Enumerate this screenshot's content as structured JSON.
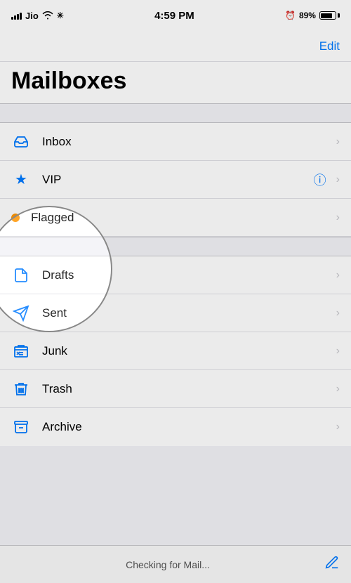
{
  "statusBar": {
    "carrier": "Jio",
    "time": "4:59 PM",
    "battery": "89%",
    "alarmIcon": "⏰"
  },
  "navBar": {
    "editLabel": "Edit"
  },
  "page": {
    "title": "Mailboxes"
  },
  "topSection": {
    "items": [
      {
        "id": "inbox",
        "label": "Inbox",
        "icon": "inbox",
        "hasInfo": false
      },
      {
        "id": "vip",
        "label": "VIP",
        "icon": "star",
        "hasInfo": true
      },
      {
        "id": "flagged",
        "label": "Flagged",
        "icon": "flag",
        "hasInfo": false
      }
    ]
  },
  "bottomSection": {
    "items": [
      {
        "id": "drafts",
        "label": "Drafts",
        "icon": "drafts"
      },
      {
        "id": "sent",
        "label": "Sent",
        "icon": "sent"
      },
      {
        "id": "junk",
        "label": "Junk",
        "icon": "junk"
      },
      {
        "id": "trash",
        "label": "Trash",
        "icon": "trash"
      },
      {
        "id": "archive",
        "label": "Archive",
        "icon": "archive"
      }
    ]
  },
  "bottomBar": {
    "statusText": "Checking for Mail...",
    "composeIcon": "compose"
  }
}
